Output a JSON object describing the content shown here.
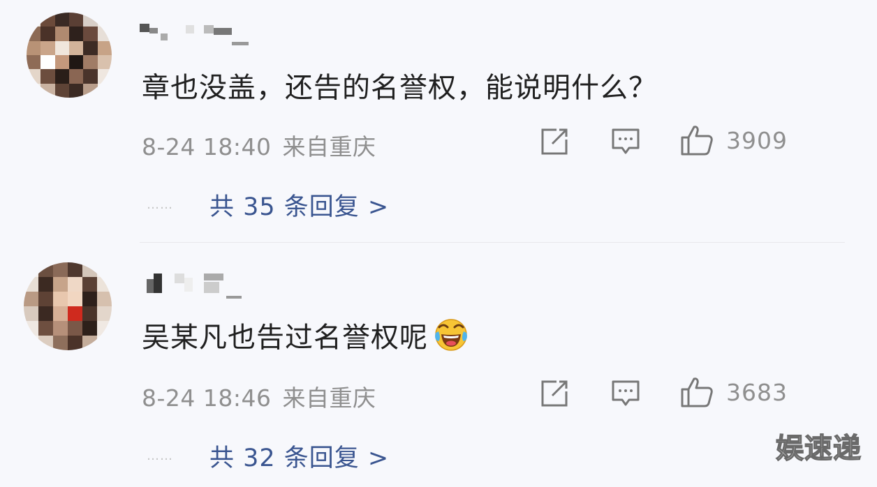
{
  "comments": [
    {
      "text": "章也没盖，还告的名誉权，能说明什么？",
      "has_emoji": false,
      "date": "8-24 18:40",
      "location": "来自重庆",
      "likes": "3909",
      "replies_label": "共 35 条回复 >"
    },
    {
      "text": "吴某凡也告过名誉权呢",
      "has_emoji": true,
      "emoji": "laughing-crying-emoji",
      "date": "8-24 18:46",
      "location": "来自重庆",
      "likes": "3683",
      "replies_label": "共 32 条回复 >"
    }
  ],
  "reply_dots": "……",
  "icons": {
    "share": "share-icon",
    "comment": "comment-icon",
    "like": "like-icon"
  },
  "colors": {
    "background": "#f7f8fc",
    "text": "#202020",
    "meta": "#8f8f8f",
    "reply_link": "#3a5590"
  },
  "watermark": "娱速递"
}
